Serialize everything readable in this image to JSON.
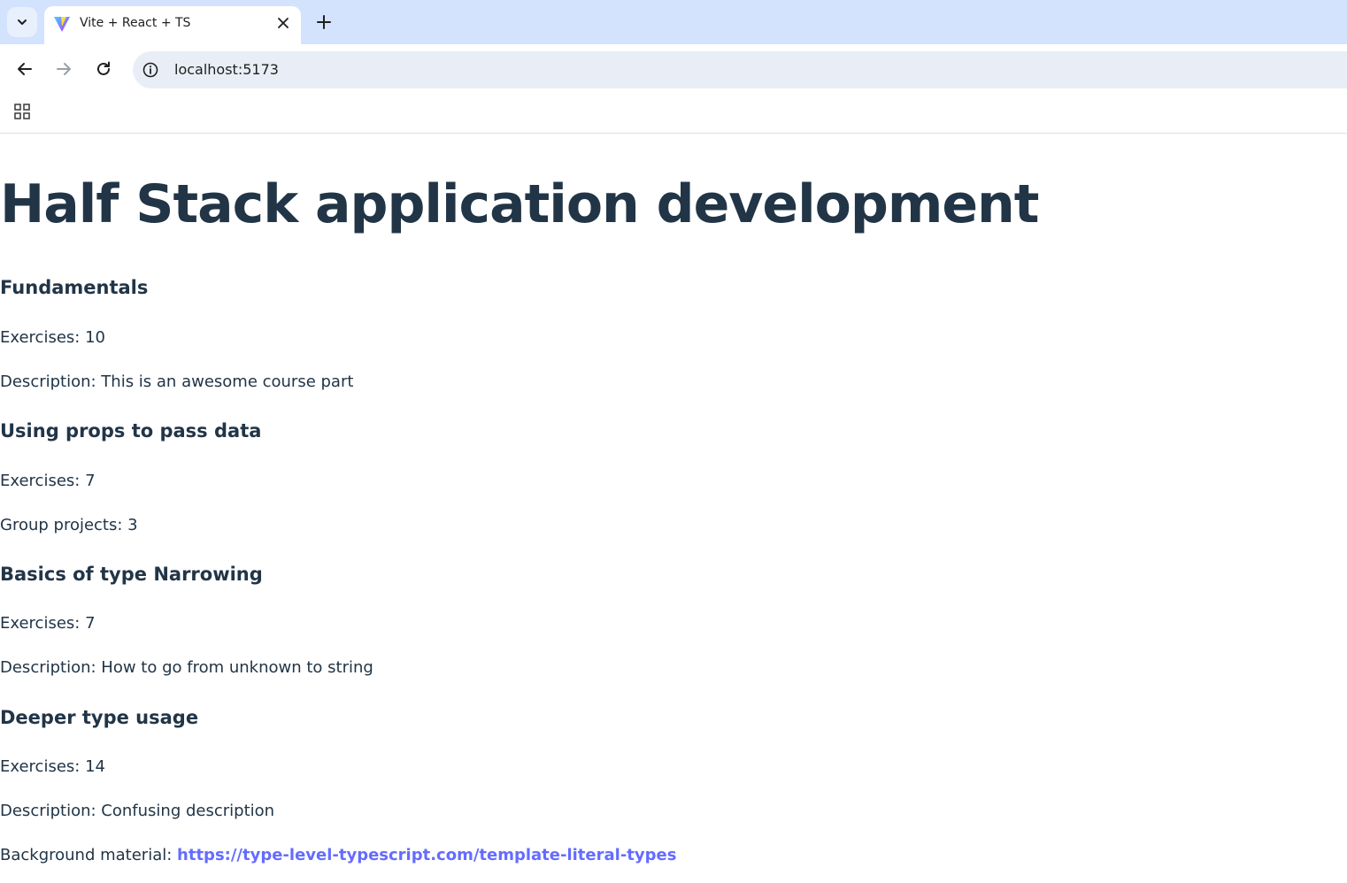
{
  "browser": {
    "tab_title": "Vite + React + TS",
    "url": "localhost:5173",
    "icons": {
      "tab_search": "chevron-down-icon",
      "favicon": "vite-logo-icon",
      "close": "close-icon",
      "new_tab": "plus-icon",
      "back": "arrow-left-icon",
      "forward": "arrow-right-icon",
      "reload": "reload-icon",
      "site_info": "info-icon",
      "apps": "apps-grid-icon"
    },
    "colors": {
      "tabstrip": "#d3e3fd",
      "omnibox": "#e9eef6"
    }
  },
  "page": {
    "title": "Half Stack application development",
    "text_color": "#213547",
    "link_color": "#646cff",
    "parts": [
      {
        "name": "Fundamentals",
        "exercises_label": "Exercises: 10",
        "detail_label": "Description: This is an awesome course part"
      },
      {
        "name": "Using props to pass data",
        "exercises_label": "Exercises: 7",
        "detail_label": "Group projects: 3"
      },
      {
        "name": "Basics of type Narrowing",
        "exercises_label": "Exercises: 7",
        "detail_label": "Description: How to go from unknown to string"
      },
      {
        "name": "Deeper type usage",
        "exercises_label": "Exercises: 14",
        "detail_label": "Description: Confusing description",
        "background_prefix": "Background material: ",
        "background_link": "https://type-level-typescript.com/template-literal-types"
      }
    ]
  }
}
